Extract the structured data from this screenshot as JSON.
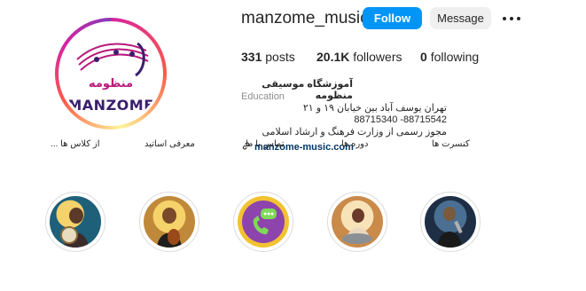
{
  "profile": {
    "username": "manzome_music",
    "avatar_text_latin": "MANZOME",
    "avatar_text_persian": "منظومه",
    "follow_label": "Follow",
    "message_label": "Message",
    "more_icon": "more-horizontal-icon"
  },
  "stats": {
    "posts_count": "331",
    "posts_label": "posts",
    "followers_count": "20.1K",
    "followers_label": "followers",
    "following_count": "0",
    "following_label": "following"
  },
  "bio": {
    "name": "آموزشگاه موسیقی منظومه",
    "category": "Education",
    "address": "تهران یوسف آباد بین خیابان ۱۹ و ۲۱",
    "phones": "88715340 -88715542",
    "license": "مجوز رسمی از وزارت فرهنگ و ارشاد اسلامی",
    "link": "manzome-music.com",
    "link_icon": "link-icon"
  },
  "highlights": [
    {
      "label": "از کلاس ها ...",
      "icon": "highlight-class-icon",
      "colors": [
        "#f2c230",
        "#1e5f7a"
      ]
    },
    {
      "label": "معرفی اساتید",
      "icon": "highlight-teachers-icon",
      "colors": [
        "#f2c230",
        "#5b3a2a"
      ]
    },
    {
      "label": "تماس با ما",
      "icon": "phone-chat-icon",
      "colors": [
        "#f2c230",
        "#8e44ad"
      ]
    },
    {
      "label": "دوره ها",
      "icon": "highlight-courses-icon",
      "colors": [
        "#f2c230",
        "#d98c3a"
      ]
    },
    {
      "label": "کنسرت ها",
      "icon": "highlight-concerts-icon",
      "colors": [
        "#f2c230",
        "#2b4a6b"
      ]
    }
  ],
  "colors": {
    "follow_button": "#0095f6",
    "message_button": "#efefef",
    "link": "#00376b",
    "muted": "#8e8e8e"
  }
}
